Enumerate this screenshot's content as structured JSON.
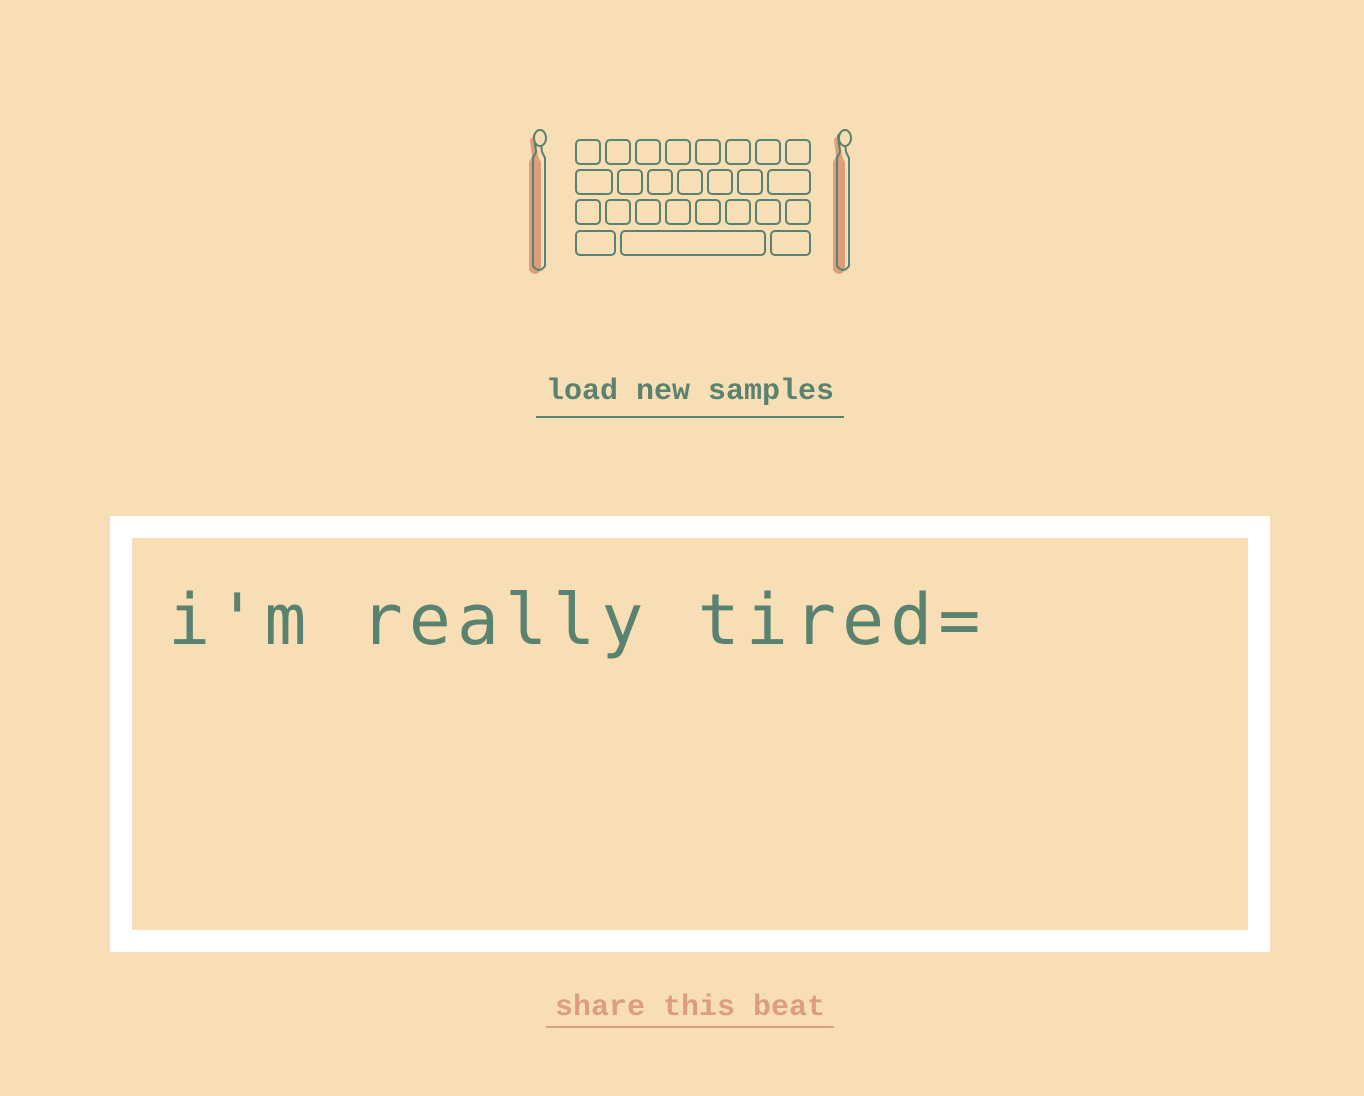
{
  "colors": {
    "background": "#f7deb4",
    "accent_green": "#5a8270",
    "accent_salmon": "#dd9e7d",
    "frame": "#ffffff"
  },
  "logo": {
    "icon": "keyboard-with-drumsticks-icon"
  },
  "load_samples": {
    "label": "load new samples"
  },
  "editor": {
    "text": "i'm really tired="
  },
  "share": {
    "label": "share this beat"
  }
}
